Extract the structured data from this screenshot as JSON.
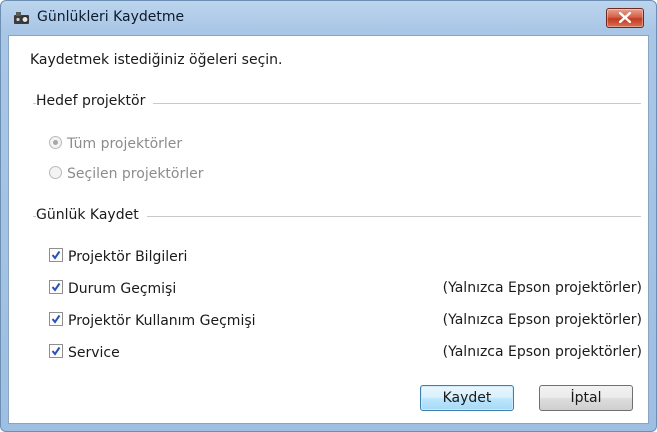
{
  "window": {
    "title": "Günlükleri Kaydetme"
  },
  "instruction": "Kaydetmek istediğiniz öğeleri seçin.",
  "target_group": {
    "label": "Hedef projektör",
    "options": [
      {
        "label": "Tüm projektörler",
        "selected": true,
        "enabled": false
      },
      {
        "label": "Seçilen projektörler",
        "selected": false,
        "enabled": false
      }
    ]
  },
  "log_group": {
    "label": "Günlük Kaydet",
    "items": [
      {
        "label": "Projektör Bilgileri",
        "checked": true,
        "note": ""
      },
      {
        "label": "Durum Geçmişi",
        "checked": true,
        "note": "(Yalnızca Epson projektörler)"
      },
      {
        "label": "Projektör Kullanım Geçmişi",
        "checked": true,
        "note": "(Yalnızca Epson projektörler)"
      },
      {
        "label": "Service",
        "checked": true,
        "note": "(Yalnızca Epson projektörler)"
      }
    ]
  },
  "buttons": {
    "save": "Kaydet",
    "cancel": "İptal"
  },
  "colors": {
    "titlebar": "#a9c6e6",
    "close": "#c23b22",
    "check": "#2b4fb5"
  }
}
